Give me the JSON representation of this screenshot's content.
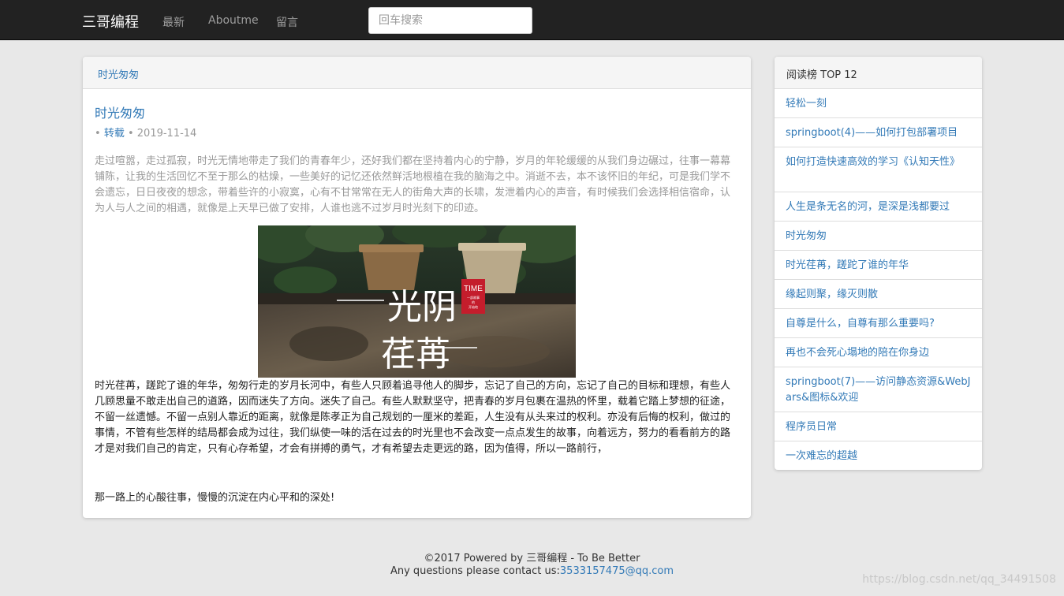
{
  "navbar": {
    "brand": "三哥编程",
    "links": [
      "最新",
      "Aboutme",
      "留言"
    ],
    "search_placeholder": "回车搜索"
  },
  "article": {
    "heading": "时光匆匆",
    "title": "时光匆匆",
    "bullet": "•",
    "category": "转载",
    "date": "2019-11-14",
    "intro": "走过喧嚣，走过孤寂，时光无情地带走了我们的青春年少，还好我们都在坚持着内心的宁静，岁月的年轮缓缓的从我们身边碾过，往事一幕幕铺陈，让我的生活回忆不至于那么的枯燥，一些美好的记忆还依然鲜活地根植在我的脑海之中。消逝不去，本不该怀旧的年纪，可是我们学不会遗忘，日日夜夜的想念，带着些许的小寂寞，心有不甘常常在无人的街角大声的长啸，发泄着内心的声音，有时候我们会选择相信宿命，认为人与人之间的相遇，就像是上天早已做了安排，人谁也逃不过岁月时光刻下的印迹。",
    "image": {
      "title_top": "光阴",
      "title_bottom": "荏苒",
      "badge": "TIME",
      "badge_sub1": "一部故事",
      "badge_sub2": "的",
      "badge_sub3": "开始地"
    },
    "body": "时光荏苒，蹉跎了谁的年华，匆匆行走的岁月长河中，有些人只顾着追寻他人的脚步，忘记了自己的方向，忘记了自己的目标和理想，有些人几顾思量不敢走出自己的道路，因而迷失了方向。迷失了自己。有些人默默坚守，把青春的岁月包裹在温热的怀里，载着它踏上梦想的征途，不留一丝遗憾。不留一点别人靠近的距离，就像是陈孝正为自己规划的一厘米的差距，人生没有从头来过的权利。亦没有后悔的权利，做过的事情，不管有些怎样的结局都会成为过往，我们纵使一味的活在过去的时光里也不会改变一点点发生的故事，向着远方，努力的看看前方的路才是对我们自己的肯定，只有心存希望，才会有拼搏的勇气，才有希望去走更远的路，因为值得，所以一路前行，",
    "closing": "那一路上的心酸往事，慢慢的沉淀在内心平和的深处!"
  },
  "sidebar": {
    "heading": "阅读榜 TOP 12",
    "items": [
      "轻松一刻",
      "springboot(4)——如何打包部署项目",
      "如何打造快速高效的学习《认知天性》",
      "人生是条无名的河，是深是浅都要过",
      "时光匆匆",
      "时光荏苒，蹉跎了谁的年华",
      "缘起则聚，缘灭则散",
      "自尊是什么，自尊有那么重要吗?",
      "再也不会死心塌地的陪在你身边",
      "springboot(7)——访问静态资源&WebJars&图标&欢迎",
      "程序员日常",
      "一次难忘的超越"
    ]
  },
  "footer": {
    "line1": "©2017 Powered by 三哥编程 - To Be Better",
    "line2_prefix": "Any questions please contact us:",
    "email": "3533157475@qq.com",
    "watermark": "https://blog.csdn.net/qq_34491508"
  },
  "colors": {
    "navbar_bg": "#222222",
    "link": "#337ab7",
    "page_bg": "#e8e8e8"
  }
}
